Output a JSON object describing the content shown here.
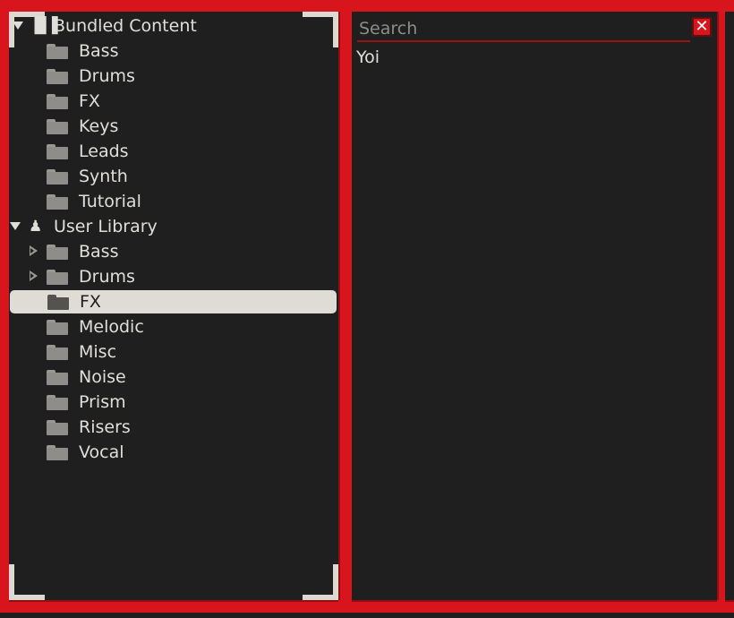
{
  "tree": {
    "bundled": {
      "label": "Bundled Content",
      "items": [
        "Bass",
        "Drums",
        "FX",
        "Keys",
        "Leads",
        "Synth",
        "Tutorial"
      ]
    },
    "user": {
      "label": "User Library",
      "items": [
        {
          "label": "Bass",
          "expandable": true
        },
        {
          "label": "Drums",
          "expandable": true
        },
        {
          "label": "FX",
          "selected": true
        },
        {
          "label": "Melodic"
        },
        {
          "label": "Misc"
        },
        {
          "label": "Noise"
        },
        {
          "label": "Prism"
        },
        {
          "label": "Risers"
        },
        {
          "label": "Vocal"
        }
      ]
    }
  },
  "search": {
    "placeholder": "Search",
    "value": "",
    "results": [
      "Yoi"
    ]
  },
  "colors": {
    "accent": "#d8141c",
    "panel": "#1f1f20",
    "selection": "#dedcd4"
  }
}
